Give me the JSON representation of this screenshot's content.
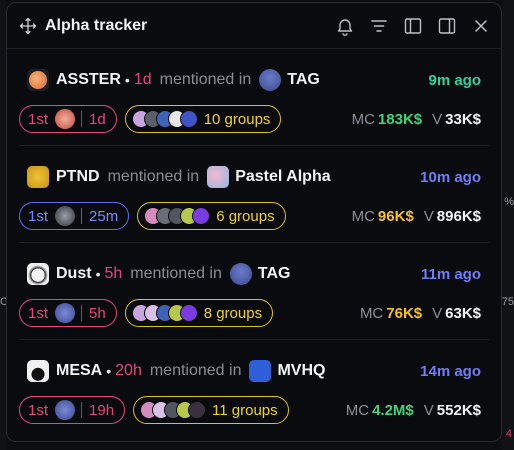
{
  "header": {
    "title": "Alpha tracker"
  },
  "edge": {
    "left_char": "C",
    "right_top": "%",
    "right_mid": "75",
    "right_bot": "4"
  },
  "colors": {
    "accent_green": "#2ed3a0",
    "accent_blue": "#6f7df7",
    "age_pink": "#e8457a",
    "gold": "#f2d21f",
    "mc_gold": "#f2c21f",
    "mc_green": "#3cd67a"
  },
  "items": [
    {
      "token": "ASSTER",
      "age": "1d",
      "mention": "mentioned in",
      "group": "TAG",
      "time": "9m ago",
      "rank": "1st",
      "ago": "1d",
      "groups": "10 groups",
      "mc_label": "MC",
      "mc": "183K$",
      "v_label": "V",
      "v": "33K$"
    },
    {
      "token": "PTND",
      "age": "",
      "mention": "mentioned in",
      "group": "Pastel Alpha",
      "time": "10m ago",
      "rank": "1st",
      "ago": "25m",
      "groups": "6 groups",
      "mc_label": "MC",
      "mc": "96K$",
      "v_label": "V",
      "v": "896K$"
    },
    {
      "token": "Dust",
      "age": "5h",
      "mention": "mentioned in",
      "group": "TAG",
      "time": "11m ago",
      "rank": "1st",
      "ago": "5h",
      "groups": "8 groups",
      "mc_label": "MC",
      "mc": "76K$",
      "v_label": "V",
      "v": "63K$"
    },
    {
      "token": "MESA",
      "age": "20h",
      "mention": "mentioned in",
      "group": "MVHQ",
      "time": "14m ago",
      "rank": "1st",
      "ago": "19h",
      "groups": "11 groups",
      "mc_label": "MC",
      "mc": "4.2M$",
      "v_label": "V",
      "v": "552K$"
    }
  ]
}
